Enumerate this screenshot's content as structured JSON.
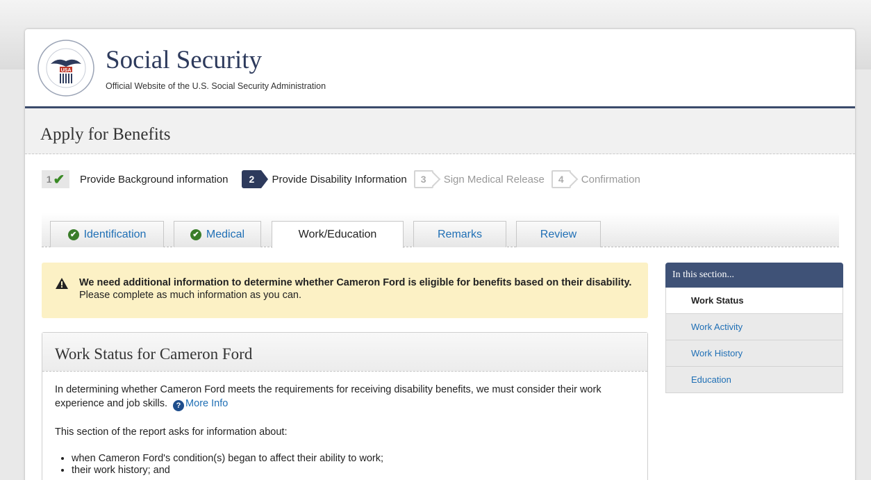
{
  "header": {
    "title": "Social Security",
    "subtitle": "Official Website of the U.S. Social Security Administration",
    "seal_text_top": "SOCIAL SECURITY",
    "seal_text_center": "USA",
    "seal_text_bottom": "ADMINISTRATION"
  },
  "page_title": "Apply for Benefits",
  "steps": [
    {
      "number": "1",
      "label": "Provide Background information",
      "state": "done"
    },
    {
      "number": "2",
      "label": "Provide Disability Information",
      "state": "active"
    },
    {
      "number": "3",
      "label": "Sign Medical Release",
      "state": "inactive"
    },
    {
      "number": "4",
      "label": "Confirmation",
      "state": "inactive"
    }
  ],
  "tabs": [
    {
      "label": "Identification",
      "complete": true
    },
    {
      "label": "Medical",
      "complete": true
    },
    {
      "label": "Work/Education",
      "active": true
    },
    {
      "label": "Remarks"
    },
    {
      "label": "Review"
    }
  ],
  "alert": {
    "bold": "We need additional information to determine whether Cameron Ford is eligible for benefits based on their disability.",
    "text": " Please complete as much information as you can."
  },
  "panel": {
    "title": "Work Status for Cameron Ford",
    "intro": "In determining whether Cameron Ford meets the requirements for receiving disability benefits, we must consider their work experience and job skills.",
    "more_info": "More Info",
    "section_text": "This section of the report asks for information about:",
    "bullets": [
      "when Cameron Ford's condition(s) began to affect their ability to work;",
      "their work history; and"
    ]
  },
  "sidebar": {
    "heading": "In this section...",
    "items": [
      {
        "label": "Work Status",
        "current": true
      },
      {
        "label": "Work Activity"
      },
      {
        "label": "Work History"
      },
      {
        "label": "Education"
      }
    ]
  },
  "colors": {
    "navy": "#2d3a5c",
    "link": "#1f6fb5",
    "alert_bg": "#fcf1c5",
    "check_green": "#3a7d2a"
  }
}
